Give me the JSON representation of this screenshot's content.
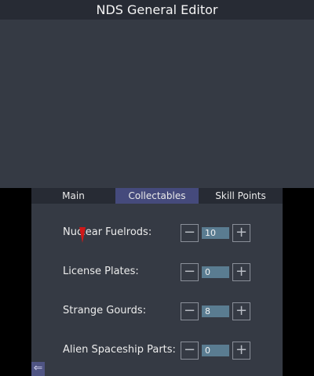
{
  "app": {
    "title": "NDS General Editor"
  },
  "tabs": [
    {
      "label": "Main",
      "active": false
    },
    {
      "label": "Collectables",
      "active": true
    },
    {
      "label": "Skill Points",
      "active": false
    }
  ],
  "rows": [
    {
      "label": "Nuclear Fuelrods:",
      "value": "10"
    },
    {
      "label": "License Plates:",
      "value": "0"
    },
    {
      "label": "Strange Gourds:",
      "value": "8"
    },
    {
      "label": "Alien Spaceship Parts:",
      "value": "0"
    }
  ],
  "stepper": {
    "minus_symbol": "−",
    "plus_symbol": "+"
  },
  "back_button": {
    "symbol": "⇐"
  },
  "colors": {
    "accent_tab": "#454a7c",
    "value_box": "#5a7c91",
    "background": "#353a44"
  }
}
